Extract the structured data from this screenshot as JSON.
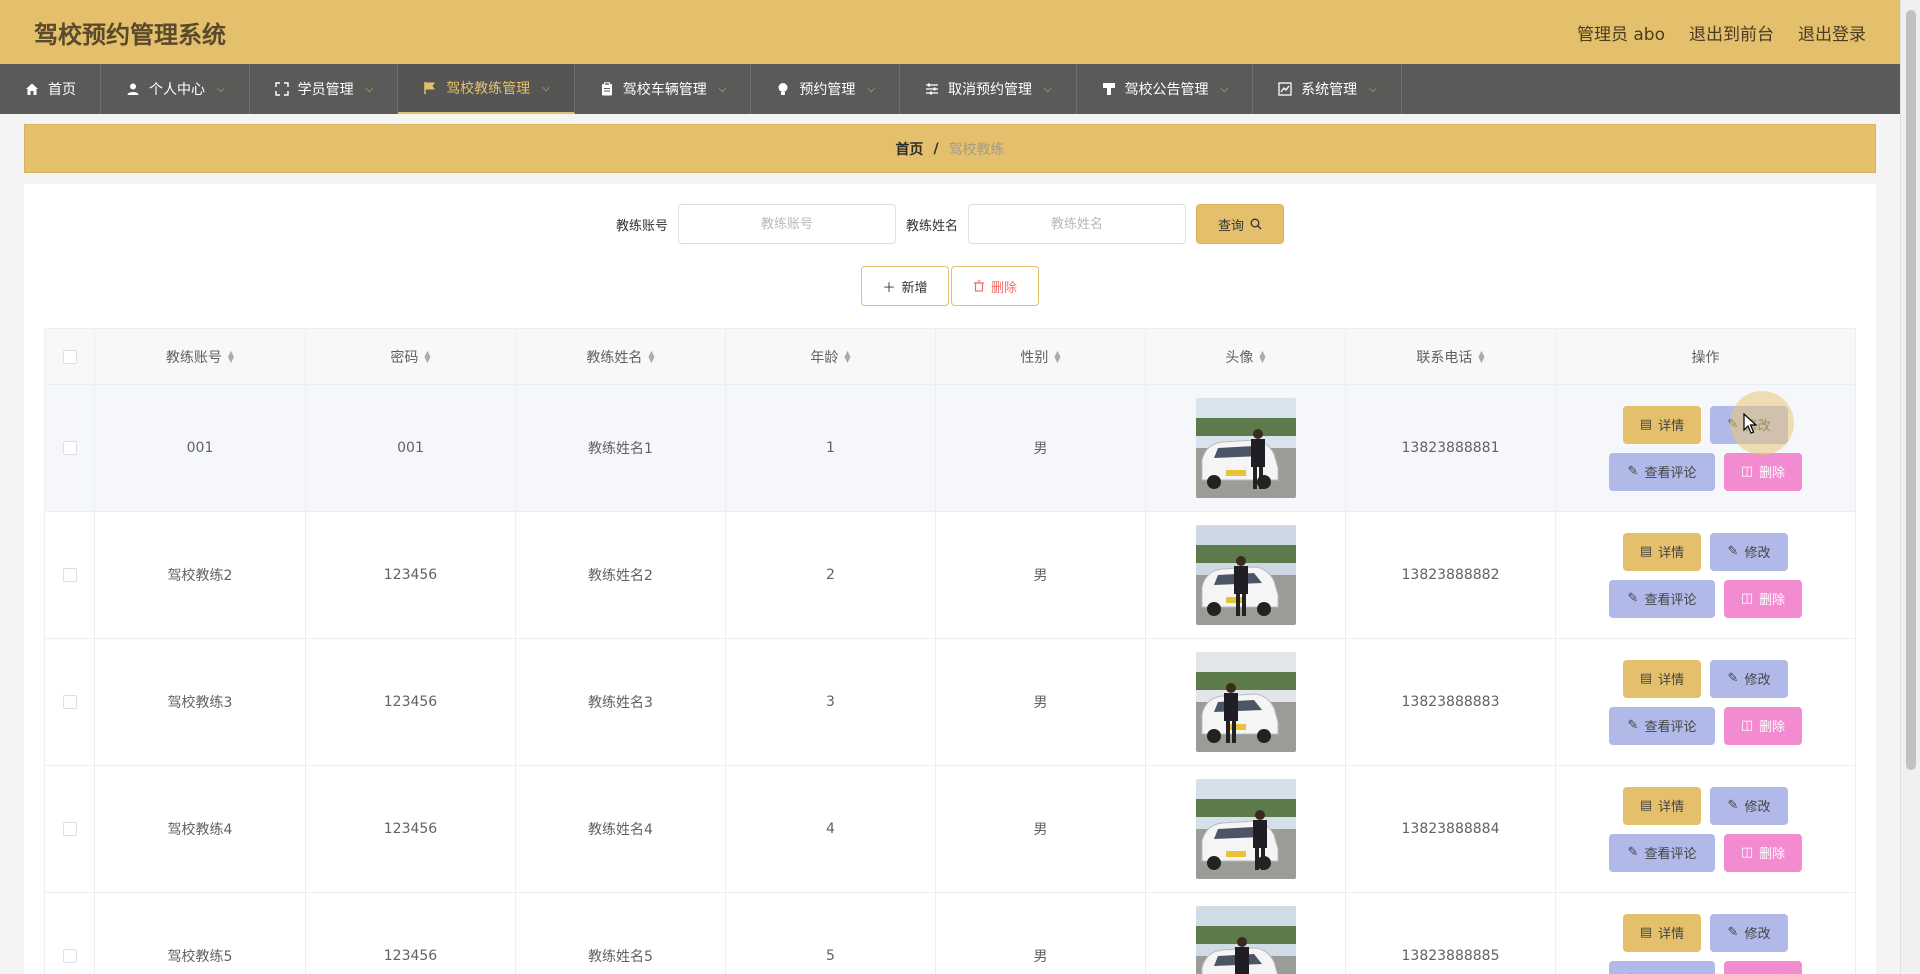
{
  "header": {
    "title": "驾校预约管理系统",
    "links": [
      "管理员 abo",
      "退出到前台",
      "退出登录"
    ]
  },
  "nav": [
    {
      "label": "首页",
      "icon": "home-icon",
      "dropdown": false,
      "active": false
    },
    {
      "label": "个人中心",
      "icon": "user-icon",
      "dropdown": true,
      "active": false
    },
    {
      "label": "学员管理",
      "icon": "fullscreen-icon",
      "dropdown": true,
      "active": false
    },
    {
      "label": "驾校教练管理",
      "icon": "flag-icon",
      "dropdown": true,
      "active": true
    },
    {
      "label": "驾校车辆管理",
      "icon": "clipboard-icon",
      "dropdown": true,
      "active": false
    },
    {
      "label": "预约管理",
      "icon": "bulb-icon",
      "dropdown": true,
      "active": false
    },
    {
      "label": "取消预约管理",
      "icon": "sliders-icon",
      "dropdown": true,
      "active": false
    },
    {
      "label": "驾校公告管理",
      "icon": "notice-icon",
      "dropdown": true,
      "active": false
    },
    {
      "label": "系统管理",
      "icon": "chart-icon",
      "dropdown": true,
      "active": false
    }
  ],
  "breadcrumb": {
    "home": "首页",
    "sep": "/",
    "current": "驾校教练"
  },
  "search": {
    "account_label": "教练账号",
    "account_placeholder": "教练账号",
    "name_label": "教练姓名",
    "name_placeholder": "教练姓名",
    "query_label": "查询"
  },
  "actions": {
    "add_label": "新增",
    "delete_label": "删除"
  },
  "table": {
    "headers": [
      "教练账号",
      "密码",
      "教练姓名",
      "年龄",
      "性别",
      "头像",
      "联系电话",
      "操作"
    ],
    "rows": [
      {
        "account": "001",
        "password": "001",
        "name": "教练姓名1",
        "age": "1",
        "gender": "男",
        "phone": "13823888881"
      },
      {
        "account": "驾校教练2",
        "password": "123456",
        "name": "教练姓名2",
        "age": "2",
        "gender": "男",
        "phone": "13823888882"
      },
      {
        "account": "驾校教练3",
        "password": "123456",
        "name": "教练姓名3",
        "age": "3",
        "gender": "男",
        "phone": "13823888883"
      },
      {
        "account": "驾校教练4",
        "password": "123456",
        "name": "教练姓名4",
        "age": "4",
        "gender": "男",
        "phone": "13823888884"
      },
      {
        "account": "驾校教练5",
        "password": "123456",
        "name": "教练姓名5",
        "age": "5",
        "gender": "男",
        "phone": "13823888885"
      }
    ],
    "ops": {
      "detail": "详情",
      "edit": "修改",
      "comment": "查看评论",
      "remove": "删除"
    }
  },
  "colors": {
    "accent": "#e4c06d",
    "nav_bg": "#5a5a58",
    "edit_btn": "#b1b9e8",
    "delete_btn": "#f28bd0"
  }
}
